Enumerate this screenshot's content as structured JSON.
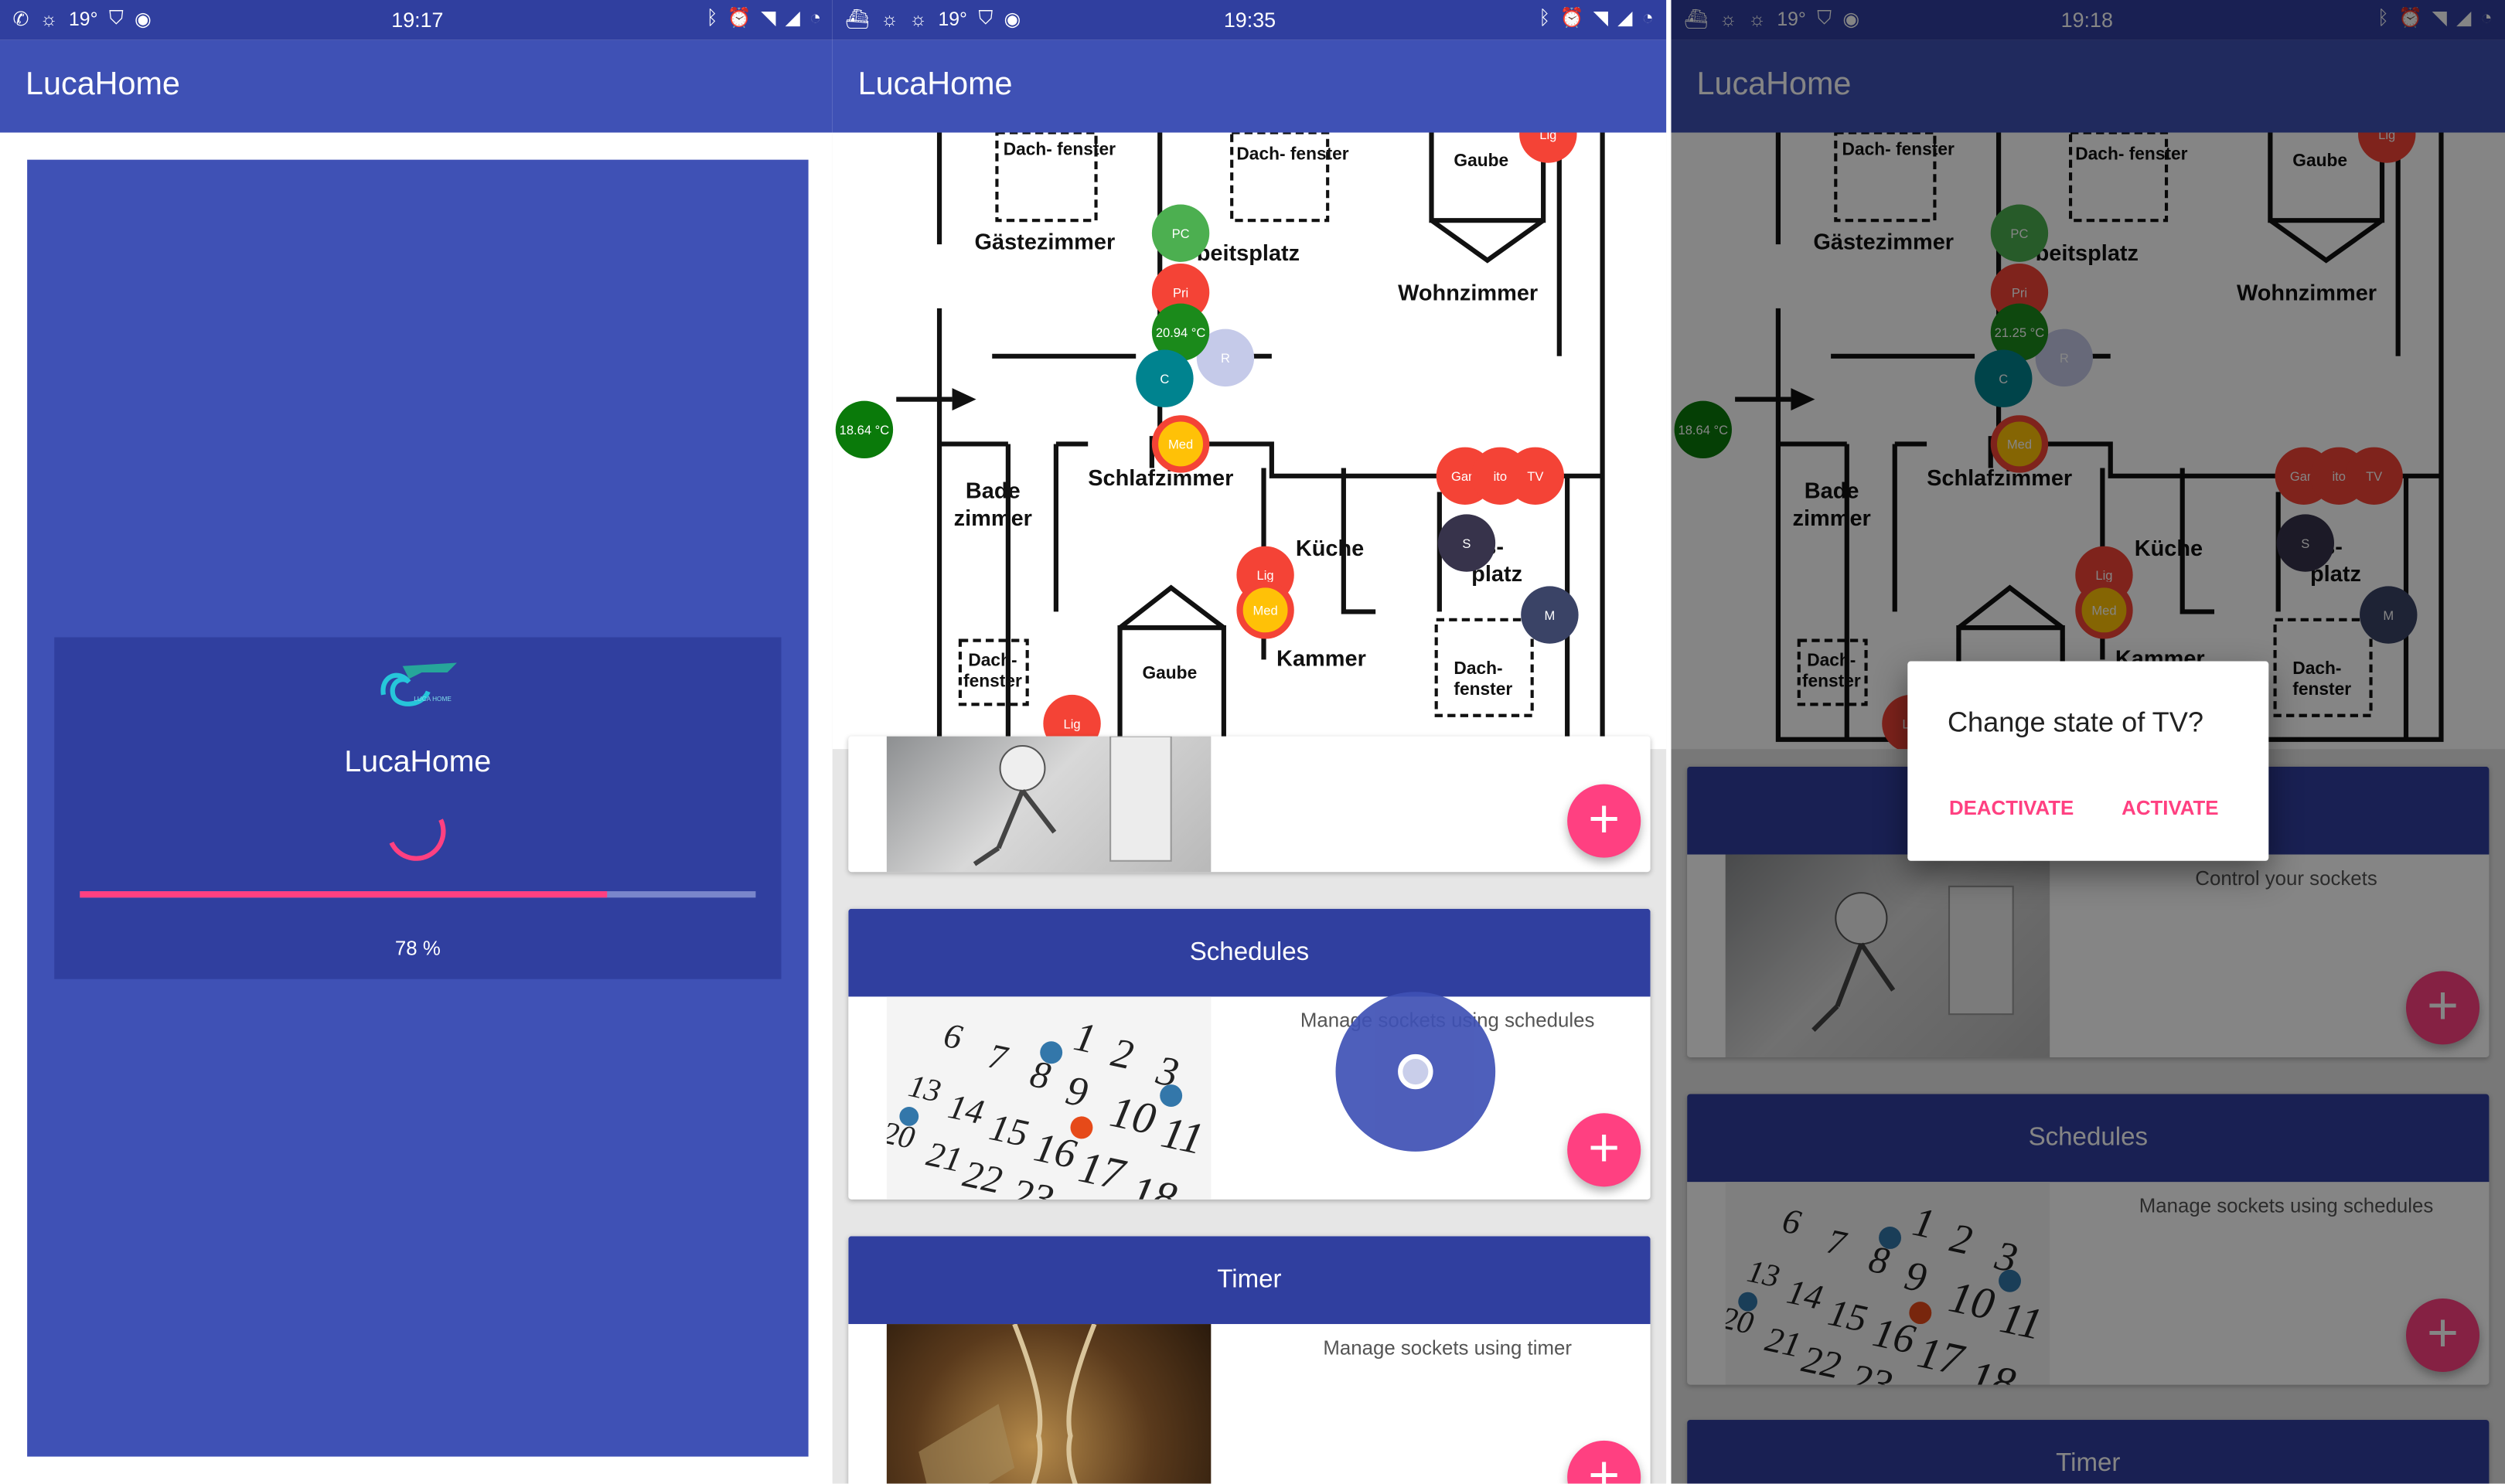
{
  "status_bars": [
    {
      "time": "19:17",
      "temp": "19°"
    },
    {
      "time": "19:35",
      "temp": "19°"
    },
    {
      "time": "19:18",
      "temp": "19°"
    }
  ],
  "app": {
    "title": "LucaHome"
  },
  "splash": {
    "app_name": "LucaHome",
    "logo_caption": "LUCA HOME",
    "progress": 0.78,
    "progress_text": "78 %"
  },
  "map": {
    "rooms": {
      "dachfenster": "Dach-\nfenster",
      "gaestezimmer": "Gästezimmer",
      "arbeitsplatz": "beitsplatz",
      "gaube": "Gaube",
      "wohnzimmer": "Wohnzimmer",
      "badezimmer": "Bade\nzimmer",
      "schlafzimmer": "Schlafzimmer",
      "kueche": "Küche",
      "essplatz": "ss-\nplatz",
      "kammer": "Kammer"
    },
    "markers": {
      "lig": "Lig",
      "pc": "PC",
      "pri": "Pri",
      "temp_a": "20.94 °C",
      "temp_b": "21.25 °C",
      "temp_outside": "18.64 °C",
      "c": "C",
      "r": "R",
      "med": "Med",
      "gam": "Gam",
      "sto": "ito",
      "tv": "TV",
      "s": "S",
      "m": "M"
    }
  },
  "cards": {
    "sockets": {
      "desc": "Control your sockets"
    },
    "schedules": {
      "title": "Schedules",
      "desc": "Manage sockets using schedules"
    },
    "timer": {
      "title": "Timer",
      "desc": "Manage sockets using timer"
    }
  },
  "fab_icon": "+",
  "dialog": {
    "question": "Change state of TV?",
    "deactivate": "DEACTIVATE",
    "activate": "ACTIVATE"
  },
  "colors": {
    "primary": "#3f51b5",
    "primary_dark": "#303f9f",
    "accent": "#ff4081",
    "marker_on": "#2e7d32",
    "marker_off": "#f44336"
  }
}
